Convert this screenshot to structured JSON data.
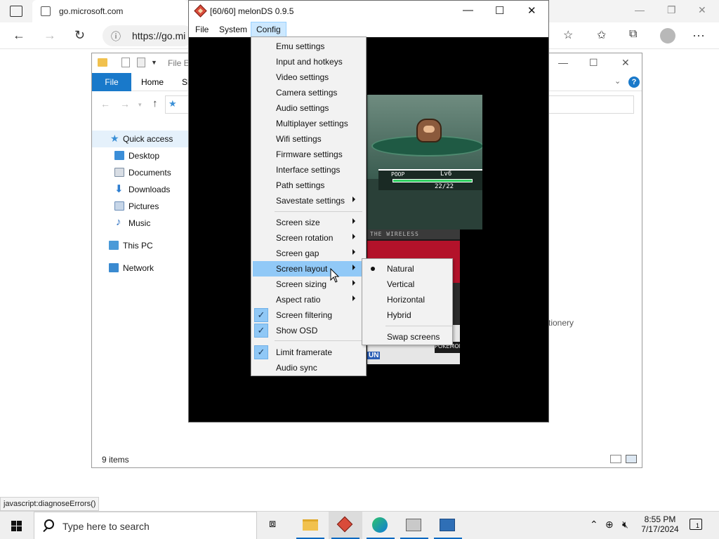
{
  "edge": {
    "tab_title": "go.microsoft.com",
    "url": "https://go.mi",
    "status_url": "javascript:diagnoseErrors()",
    "icons": [
      "tab-actions-icon",
      "back-icon",
      "forward-icon",
      "refresh-icon",
      "info-icon",
      "add-favorite-icon",
      "favorites-icon",
      "collections-icon",
      "profile-icon",
      "more-icon"
    ]
  },
  "explorer": {
    "title": "File E",
    "ribbon": {
      "file": "File",
      "home": "Home",
      "share": "Sh"
    },
    "help": "?",
    "nav_pane": [
      {
        "label": "Quick access",
        "icon": "star-icon",
        "color": "#3a8fd6"
      },
      {
        "label": "Desktop",
        "icon": "desktop-icon",
        "color": "#3b8ed8"
      },
      {
        "label": "Documents",
        "icon": "documents-icon",
        "color": "#7d8ea3"
      },
      {
        "label": "Downloads",
        "icon": "downloads-icon",
        "color": "#2f7fd0"
      },
      {
        "label": "Pictures",
        "icon": "pictures-icon",
        "color": "#6d8fb8"
      },
      {
        "label": "Music",
        "icon": "music-icon",
        "color": "#2b6fc0"
      },
      {
        "label": "This PC",
        "icon": "computer-icon",
        "color": "#4a9ad8"
      },
      {
        "label": "Network",
        "icon": "network-icon",
        "color": "#3a8ad0"
      }
    ],
    "partial_text": "tationery",
    "status": "9 items"
  },
  "melon": {
    "title": "[60/60] melonDS 0.9.5",
    "menubar": [
      "File",
      "System",
      "Config"
    ],
    "game": {
      "pokemon_name": "POOP",
      "level": "Lv6",
      "hp": "22/22",
      "wireless_text": "THE WIRELESS",
      "run_text": "UN",
      "bottom_text": "POKEMON"
    }
  },
  "config_menu": {
    "group1": [
      "Emu settings",
      "Input and hotkeys",
      "Video settings",
      "Camera settings",
      "Audio settings",
      "Multiplayer settings",
      "Wifi settings",
      "Firmware settings",
      "Interface settings",
      "Path settings",
      "Savestate settings"
    ],
    "group2": [
      "Screen size",
      "Screen rotation",
      "Screen gap",
      "Screen layout",
      "Screen sizing",
      "Aspect ratio",
      "Screen filtering",
      "Show OSD"
    ],
    "group3": [
      "Limit framerate",
      "Audio sync"
    ],
    "checked": [
      "Screen filtering",
      "Show OSD",
      "Limit framerate"
    ],
    "highlighted": "Screen layout"
  },
  "layout_submenu": {
    "items": [
      "Natural",
      "Vertical",
      "Horizontal",
      "Hybrid"
    ],
    "selected": "Natural",
    "extra": "Swap screens"
  },
  "taskbar": {
    "search_placeholder": "Type here to search",
    "apps": [
      "task-view-icon",
      "file-explorer-icon",
      "melonds-icon",
      "edge-icon",
      "installer-icon",
      "control-panel-icon"
    ],
    "time": "8:55 PM",
    "date": "7/17/2024",
    "notification_count": "1"
  }
}
